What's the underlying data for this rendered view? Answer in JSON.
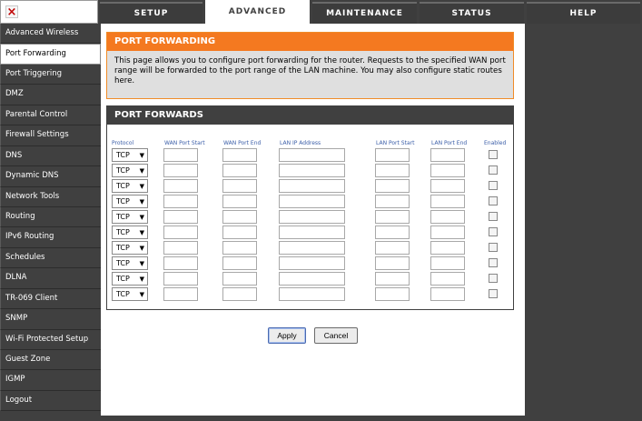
{
  "logo": {
    "icon": "close-x-icon",
    "glyph": "×"
  },
  "nav": {
    "tabs": [
      {
        "label": "SETUP",
        "active": false
      },
      {
        "label": "ADVANCED",
        "active": true
      },
      {
        "label": "MAINTENANCE",
        "active": false
      },
      {
        "label": "STATUS",
        "active": false
      },
      {
        "label": "HELP",
        "active": false
      }
    ]
  },
  "sidebar": {
    "items": [
      {
        "label": "Advanced Wireless",
        "active": false
      },
      {
        "label": "Port Forwarding",
        "active": true
      },
      {
        "label": "Port Triggering",
        "active": false
      },
      {
        "label": "DMZ",
        "active": false
      },
      {
        "label": "Parental Control",
        "active": false
      },
      {
        "label": "Firewall Settings",
        "active": false
      },
      {
        "label": "DNS",
        "active": false
      },
      {
        "label": "Dynamic DNS",
        "active": false
      },
      {
        "label": "Network Tools",
        "active": false
      },
      {
        "label": "Routing",
        "active": false
      },
      {
        "label": "IPv6 Routing",
        "active": false
      },
      {
        "label": "Schedules",
        "active": false
      },
      {
        "label": "DLNA",
        "active": false
      },
      {
        "label": "TR-069 Client",
        "active": false
      },
      {
        "label": "SNMP",
        "active": false
      },
      {
        "label": "Wi-Fi Protected Setup",
        "active": false
      },
      {
        "label": "Guest Zone",
        "active": false
      },
      {
        "label": "IGMP",
        "active": false
      },
      {
        "label": "Logout",
        "active": false
      }
    ]
  },
  "port_forwarding": {
    "title": "PORT FORWARDING",
    "description": "This page allows you to configure port forwarding for the router. Requests to the specified WAN port range will be forwarded to the port range of the LAN machine. You may also configure static routes here."
  },
  "port_forwards": {
    "title": "PORT FORWARDS",
    "columns": {
      "protocol": "Protocol",
      "wan_start": "WAN Port Start",
      "wan_end": "WAN Port End",
      "lan_ip": "LAN IP Address",
      "lan_start": "LAN Port Start",
      "lan_end": "LAN Port End",
      "enabled": "Enabled"
    },
    "rows": [
      {
        "protocol": "TCP",
        "wan_start": "",
        "wan_end": "",
        "lan_ip": "",
        "lan_start": "",
        "lan_end": "",
        "enabled": false
      },
      {
        "protocol": "TCP",
        "wan_start": "",
        "wan_end": "",
        "lan_ip": "",
        "lan_start": "",
        "lan_end": "",
        "enabled": false
      },
      {
        "protocol": "TCP",
        "wan_start": "",
        "wan_end": "",
        "lan_ip": "",
        "lan_start": "",
        "lan_end": "",
        "enabled": false
      },
      {
        "protocol": "TCP",
        "wan_start": "",
        "wan_end": "",
        "lan_ip": "",
        "lan_start": "",
        "lan_end": "",
        "enabled": false
      },
      {
        "protocol": "TCP",
        "wan_start": "",
        "wan_end": "",
        "lan_ip": "",
        "lan_start": "",
        "lan_end": "",
        "enabled": false
      },
      {
        "protocol": "TCP",
        "wan_start": "",
        "wan_end": "",
        "lan_ip": "",
        "lan_start": "",
        "lan_end": "",
        "enabled": false
      },
      {
        "protocol": "TCP",
        "wan_start": "",
        "wan_end": "",
        "lan_ip": "",
        "lan_start": "",
        "lan_end": "",
        "enabled": false
      },
      {
        "protocol": "TCP",
        "wan_start": "",
        "wan_end": "",
        "lan_ip": "",
        "lan_start": "",
        "lan_end": "",
        "enabled": false
      },
      {
        "protocol": "TCP",
        "wan_start": "",
        "wan_end": "",
        "lan_ip": "",
        "lan_start": "",
        "lan_end": "",
        "enabled": false
      },
      {
        "protocol": "TCP",
        "wan_start": "",
        "wan_end": "",
        "lan_ip": "",
        "lan_start": "",
        "lan_end": "",
        "enabled": false
      }
    ],
    "protocol_dropdown_icon": "chevron-down-icon"
  },
  "buttons": {
    "apply": "Apply",
    "cancel": "Cancel"
  },
  "colors": {
    "orange_header": "#f47920",
    "dark_gray": "#404040",
    "panel_gray": "#dfdfdf",
    "column_blue": "#3b5ea8"
  }
}
